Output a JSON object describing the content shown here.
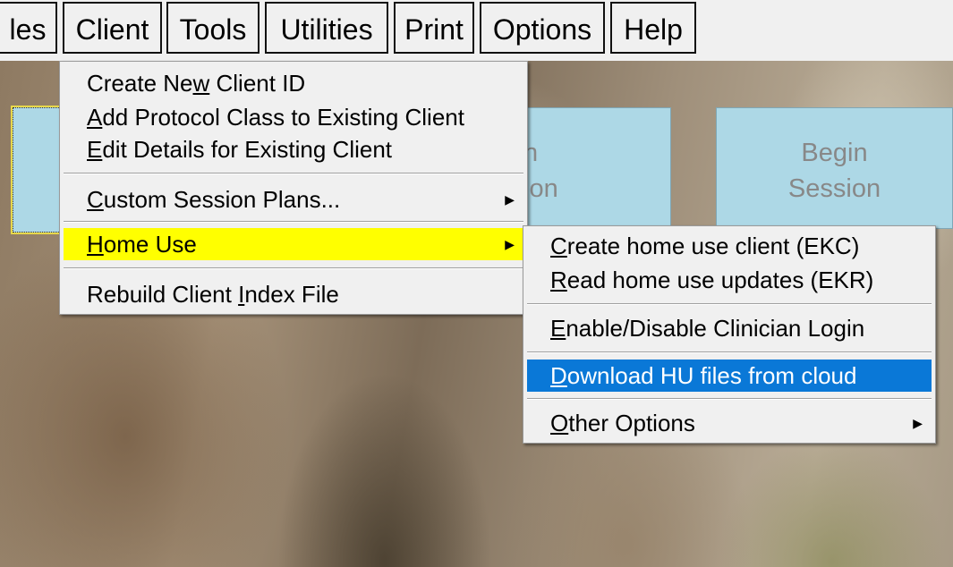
{
  "menubar": {
    "items": [
      {
        "label": "les"
      },
      {
        "label": "Client"
      },
      {
        "label": "Tools"
      },
      {
        "label": "Utilities"
      },
      {
        "label": "Print"
      },
      {
        "label": "Options"
      },
      {
        "label": "Help"
      }
    ]
  },
  "tiles": [
    {
      "line1": "",
      "line2": ""
    },
    {
      "line1": "n",
      "line2": "ion"
    },
    {
      "line1": "Begin",
      "line2": "Session"
    }
  ],
  "client_menu": {
    "items": [
      {
        "pre": "Create Ne",
        "mn": "w",
        "post": " Client ID"
      },
      {
        "pre": "",
        "mn": "A",
        "post": "dd Protocol Class to Existing Client"
      },
      {
        "pre": "",
        "mn": "E",
        "post": "dit Details for Existing Client"
      },
      {
        "pre": "",
        "mn": "C",
        "post": "ustom Session Plans..."
      },
      {
        "pre": "",
        "mn": "H",
        "post": "ome Use"
      },
      {
        "pre": "Rebuild Client ",
        "mn": "I",
        "post": "ndex File"
      }
    ]
  },
  "home_use_menu": {
    "items": [
      {
        "pre": "",
        "mn": "C",
        "post": "reate home use client (EKC)"
      },
      {
        "pre": "",
        "mn": "R",
        "post": "ead home use updates (EKR)"
      },
      {
        "pre": "",
        "mn": "E",
        "post": "nable/Disable Clinician Login"
      },
      {
        "pre": "",
        "mn": "D",
        "post": "ownload HU files from cloud"
      },
      {
        "pre": "",
        "mn": "O",
        "post": "ther Options"
      }
    ]
  },
  "colors": {
    "tile": "#add8e6",
    "highlight_yellow": "#ffff00",
    "highlight_blue": "#0a78d7"
  },
  "icons": {
    "submenu_arrow": "submenu-arrow-icon"
  }
}
